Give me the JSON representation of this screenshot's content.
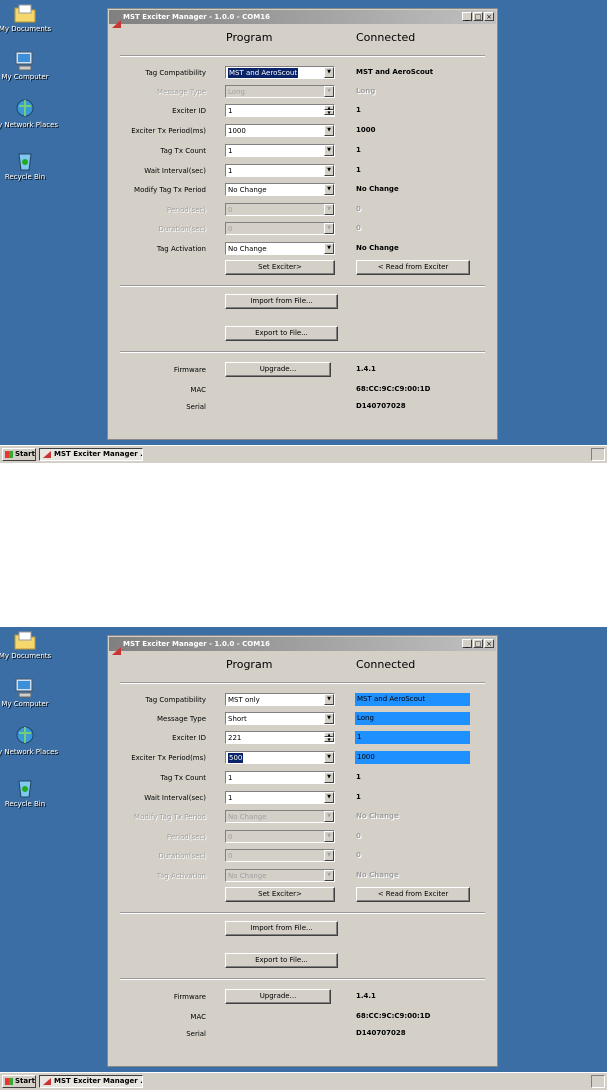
{
  "desktop": {
    "icons": [
      "My Documents",
      "My Computer",
      "My Network Places",
      "Recycle Bin"
    ]
  },
  "taskbar": {
    "start_label": "Start",
    "task_label": "MST Exciter Manager ..."
  },
  "window": {
    "title": "MST Exciter Manager - 1.0.0 - COM16",
    "header_program": "Program",
    "header_connected": "Connected",
    "buttons": {
      "set": "Set Exciter>",
      "read": "< Read from Exciter",
      "import": "Import from File...",
      "export": "Export to File...",
      "upgrade": "Upgrade..."
    },
    "labels": {
      "tag_compat": "Tag Compatibility",
      "msg_type": "Message Type",
      "exciter_id": "Exciter ID",
      "tx_period": "Exciter Tx Period(ms)",
      "tx_count": "Tag Tx Count",
      "wait": "Wait Interval(sec)",
      "modify": "Modify Tag Tx Period",
      "period": "Period(sec)",
      "duration": "Duration(sec)",
      "activation": "Tag Activation",
      "firmware": "Firmware",
      "mac": "MAC",
      "serial": "Serial"
    },
    "info": {
      "firmware": "1.4.1",
      "mac": "68:CC:9C:C9:00:1D",
      "serial": "D140707028"
    }
  },
  "screens": [
    {
      "fields": {
        "tag_compat": {
          "program": "MST and AeroScout",
          "connected": "MST and AeroScout"
        },
        "msg_type": {
          "program": "Long",
          "connected": "Long"
        },
        "exciter_id": {
          "program": "1",
          "connected": "1"
        },
        "tx_period": {
          "program": "1000",
          "connected": "1000"
        },
        "tx_count": {
          "program": "1",
          "connected": "1"
        },
        "wait": {
          "program": "1",
          "connected": "1"
        },
        "modify": {
          "program": "No Change",
          "connected": "No Change"
        },
        "period": {
          "program": "0",
          "connected": "0"
        },
        "duration": {
          "program": "0",
          "connected": "0"
        },
        "activation": {
          "program": "No Change",
          "connected": "No Change"
        }
      }
    },
    {
      "fields": {
        "tag_compat": {
          "program": "MST only",
          "connected": "MST and AeroScout"
        },
        "msg_type": {
          "program": "Short",
          "connected": "Long"
        },
        "exciter_id": {
          "program": "221",
          "connected": "1"
        },
        "tx_period": {
          "program": "500",
          "connected": "1000"
        },
        "tx_count": {
          "program": "1",
          "connected": "1"
        },
        "wait": {
          "program": "1",
          "connected": "1"
        },
        "modify": {
          "program": "No Change",
          "connected": "No Change"
        },
        "period": {
          "program": "0",
          "connected": "0"
        },
        "duration": {
          "program": "0",
          "connected": "0"
        },
        "activation": {
          "program": "No Change",
          "connected": "No Change"
        }
      }
    }
  ],
  "colors": {
    "desktop": "#3a6ea5",
    "window": "#d4d0c8",
    "highlight": "#1e90ff",
    "selection": "#0a246a"
  }
}
